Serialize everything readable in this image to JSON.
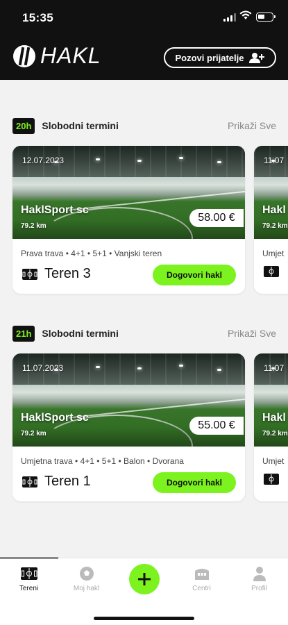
{
  "status_bar": {
    "time": "15:35"
  },
  "header": {
    "logo_text": "HAKL",
    "invite_label": "Pozovi prijatelje"
  },
  "sections": [
    {
      "badge": "20h",
      "title": "Slobodni termini",
      "show_all": "Prikaži Sve",
      "card": {
        "date": "12.07.2023",
        "venue": "HaklSport sc",
        "distance": "79.2 km",
        "price": "58.00 €",
        "tags": "Prava trava • 4+1 • 5+1 • Vanjski teren",
        "court": "Teren 3",
        "cta": "Dogovori hakl"
      },
      "peek": {
        "date": "11.07",
        "venue": "Hakl",
        "distance": "79.2 km",
        "tags": "Umjet",
        "court": ""
      }
    },
    {
      "badge": "21h",
      "title": "Slobodni termini",
      "show_all": "Prikaži Sve",
      "card": {
        "date": "11.07.2023",
        "venue": "HaklSport sc",
        "distance": "79.2 km",
        "price": "55.00 €",
        "tags": "Umjetna trava • 4+1 • 5+1 • Balon • Dvorana",
        "court": "Teren 1",
        "cta": "Dogovori hakl"
      },
      "peek": {
        "date": "11.07",
        "venue": "Hakl",
        "distance": "79.2 km",
        "tags": "Umjet",
        "court": ""
      }
    }
  ],
  "tabbar": {
    "items": [
      {
        "label": "Tereni",
        "icon": "field-icon"
      },
      {
        "label": "Moj hakl",
        "icon": "ball-icon"
      },
      {
        "label": "Centri",
        "icon": "stadium-icon"
      },
      {
        "label": "Profil",
        "icon": "user-icon"
      }
    ],
    "active_index": 0
  },
  "colors": {
    "accent": "#7cf21f",
    "header_bg": "#111111",
    "page_bg": "#f2f2f2"
  }
}
